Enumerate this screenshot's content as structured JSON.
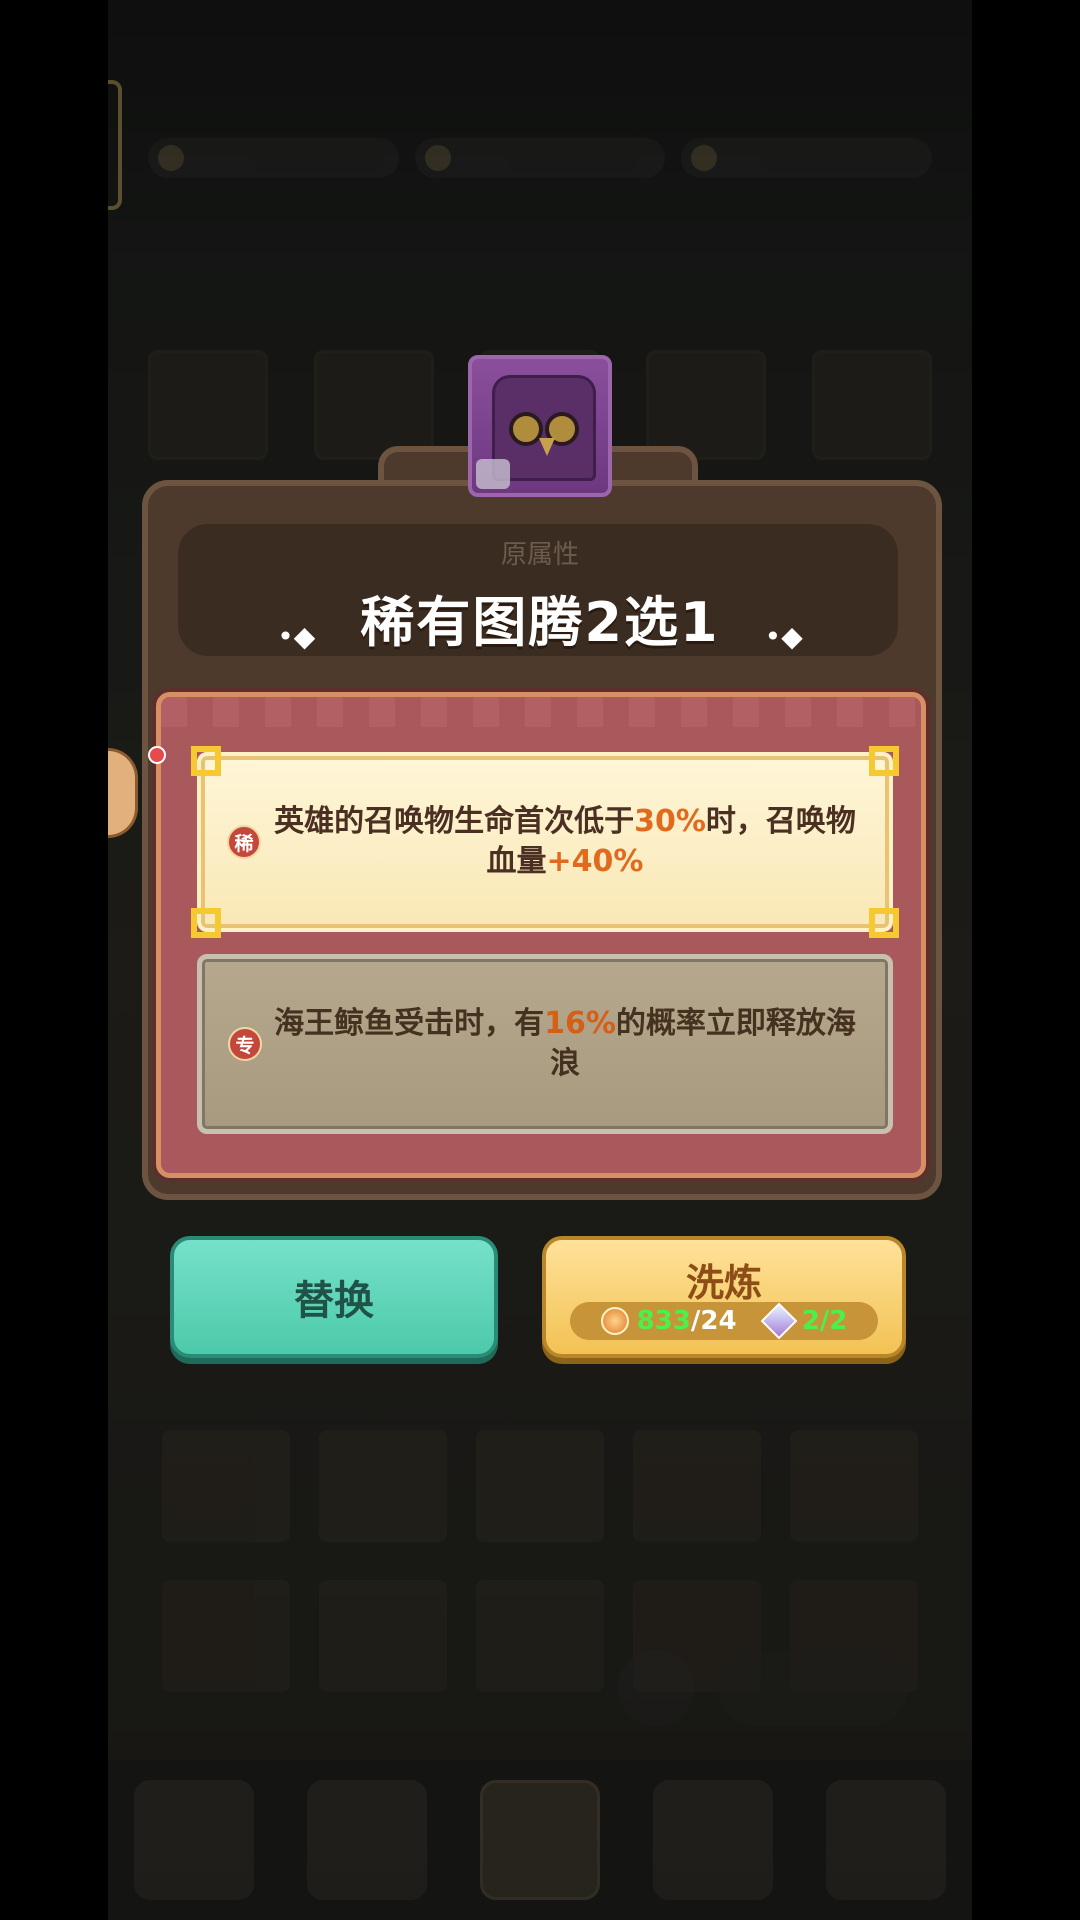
{
  "popup": {
    "original_attr_label": "原属性",
    "title": "稀有图腾2选1",
    "title_decor": "•◆"
  },
  "options": [
    {
      "badge": "稀",
      "text_parts": [
        "英雄的召唤物生命首次低于",
        "30%",
        "时，召唤物血量",
        "+40%"
      ],
      "selected": true
    },
    {
      "badge": "专",
      "text_parts": [
        "海王鲸鱼受击时，有",
        "16%",
        "的概率立即释放海浪"
      ],
      "selected": false
    }
  ],
  "buttons": {
    "replace": "替换",
    "refine": "洗炼",
    "cost_orange_have": "833",
    "cost_orange_need": "/24",
    "cost_gem": "2/2"
  },
  "colors": {
    "replace_green": "#4ccaa9",
    "refine_gold": "#f2c253",
    "highlight_orange": "#e06a1e",
    "panel_rose": "#a9585c"
  }
}
